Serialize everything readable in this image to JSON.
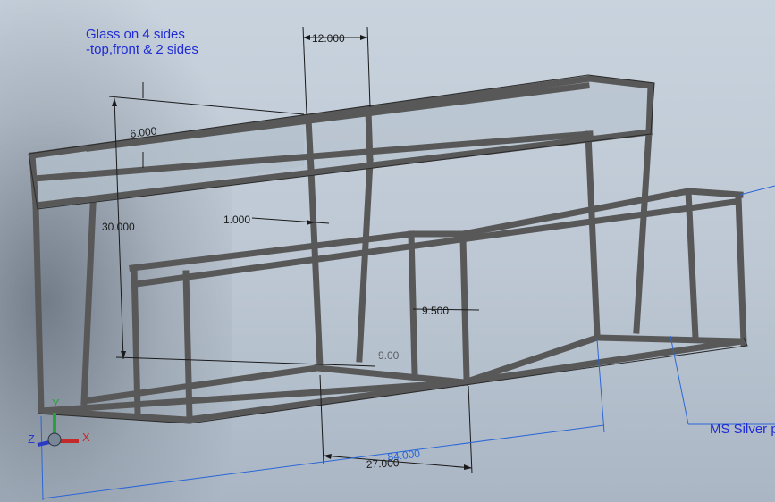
{
  "note": {
    "line1": "Glass on 4 sides",
    "line2": "-top,front & 2 sides"
  },
  "dimensions": {
    "d_12": "12.000",
    "d_6": "6.000",
    "d_30": "30.000",
    "d_1": "1.000",
    "d_9_5": "9.500",
    "d_hidden": "9.00",
    "d_84": "84.000",
    "d_27": "27.000"
  },
  "callout": {
    "text": "MS Silver p"
  },
  "triad": {
    "x_label": "X",
    "y_label": "Y",
    "z_label": "Z"
  },
  "colors": {
    "frame": "#585858",
    "glass": "#b3bfcb",
    "annotation_blue": "#1f2bd6",
    "dimension_blue": "#2a66d9"
  }
}
